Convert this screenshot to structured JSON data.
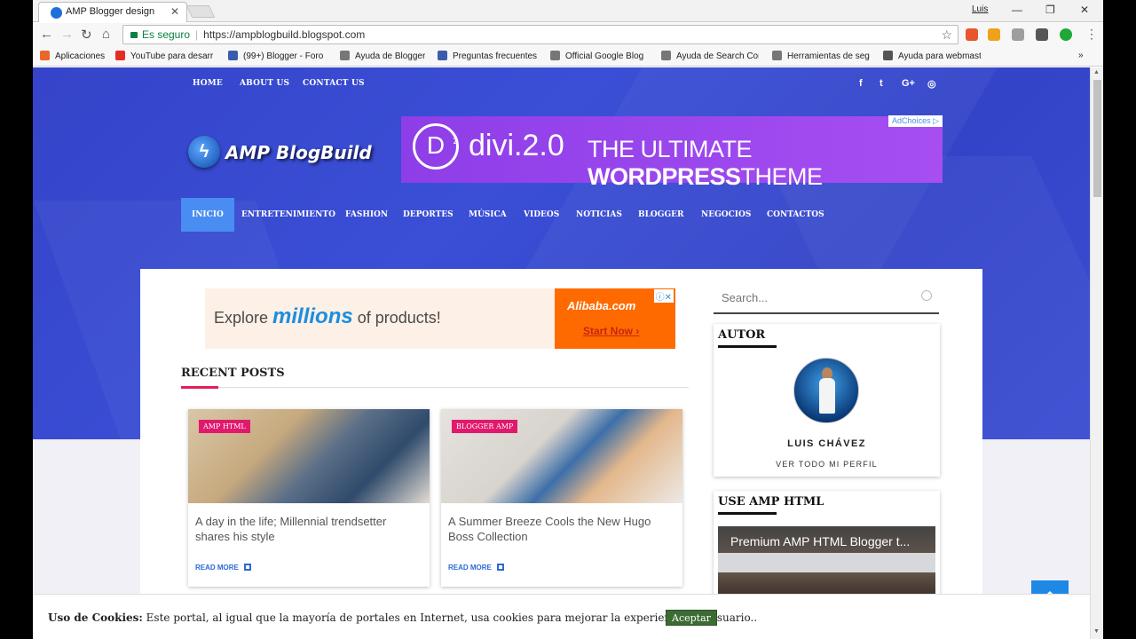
{
  "browser": {
    "tab_title": "AMP Blogger design",
    "tab_close": "✕",
    "user": "Luis",
    "security_label": "Es seguro",
    "url": "https://ampblogbuild.blogspot.com",
    "bookmarks": [
      {
        "label": "Aplicaciones",
        "icon": "apps-grid-icon",
        "color": "#e8672a"
      },
      {
        "label": "YouTube para desarr",
        "icon": "youtube-icon",
        "color": "#e52d27"
      },
      {
        "label": "(99+) Blogger - Foro",
        "icon": "blogger-forum-icon",
        "color": "#3b5cad"
      },
      {
        "label": "Ayuda de Blogger",
        "icon": "google-icon",
        "color": "#777777"
      },
      {
        "label": "Preguntas frecuentes",
        "icon": "blogger-forum-icon",
        "color": "#3b5cad"
      },
      {
        "label": "Official Google Blog",
        "icon": "google-icon",
        "color": "#777777"
      },
      {
        "label": "Ayuda de Search Con",
        "icon": "google-icon",
        "color": "#777777"
      },
      {
        "label": "Herramientas de seg",
        "icon": "google-icon",
        "color": "#777777"
      },
      {
        "label": "Ayuda para webmast",
        "icon": "code-icon",
        "color": "#555555"
      }
    ],
    "more_bookmarks": "»"
  },
  "site": {
    "topnav": [
      "HOME",
      "ABOUT US",
      "CONTACT US"
    ],
    "social": [
      "f",
      "t",
      "G+",
      "◎"
    ],
    "logo_text": "AMP BlogBuild",
    "banner": {
      "badge": "D",
      "badge_sup": "2",
      "product": "divi.2.0",
      "tagline_pre": "THE ULTIMATE ",
      "tagline_bold": "WORDPRESS",
      "tagline_post": "THEME",
      "adchoices": "AdChoices ▷"
    },
    "mainnav": [
      "INICIO",
      "ENTRETENIMIENTO",
      "FASHION",
      "DEPORTES",
      "MÚSICA",
      "VIDEOS",
      "NOTICIAS",
      "BLOGGER",
      "NEGOCIOS",
      "CONTACTOS"
    ],
    "ad2": {
      "explore_pre": "Explore ",
      "explore_bold": "millions",
      "explore_post": " of products!",
      "brand": "Alibaba.com",
      "cta": "Start Now ›",
      "close": "ⓘ✕"
    },
    "recent_posts_title": "RECENT POSTS",
    "posts": [
      {
        "label": "AMP HTML",
        "title": "A day in the life; Millennial trendsetter shares his style",
        "more": "READ MORE"
      },
      {
        "label": "BLOGGER AMP",
        "title": "A Summer Breeze Cools the New Hugo Boss Collection",
        "more": "READ MORE"
      }
    ],
    "search_placeholder": "Search...",
    "autor": {
      "title": "AUTOR",
      "name": "LUIS CHÁVEZ",
      "link": "VER TODO MI PERFIL"
    },
    "use_amp": {
      "title": "USE AMP HTML",
      "video_title": "Premium AMP HTML Blogger t..."
    },
    "cookie": {
      "label": "Uso de Cookies:",
      "text": " Este portal, al igual que la mayoría de portales en Internet, usa cookies para mejorar la experiencia del usuario..",
      "button": "Aceptar"
    },
    "to_top": "⌃"
  }
}
